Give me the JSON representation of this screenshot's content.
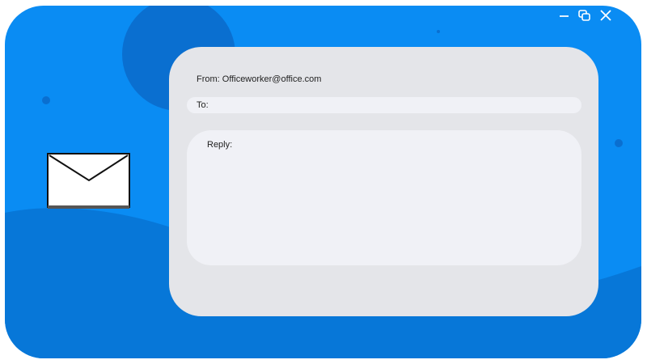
{
  "window": {
    "controls": {
      "minimize": "minimize-icon",
      "restore": "restore-icon",
      "close": "close-icon"
    }
  },
  "email": {
    "from_line": "From: Officeworker@office.com",
    "to_label": "To:",
    "reply_label": "Reply:"
  },
  "colors": {
    "background": "#0a8cf3",
    "wave": "#0777d8",
    "card": "#e4e5e9",
    "field": "#f0f1f6"
  },
  "icons": {
    "envelope": "envelope-icon"
  }
}
